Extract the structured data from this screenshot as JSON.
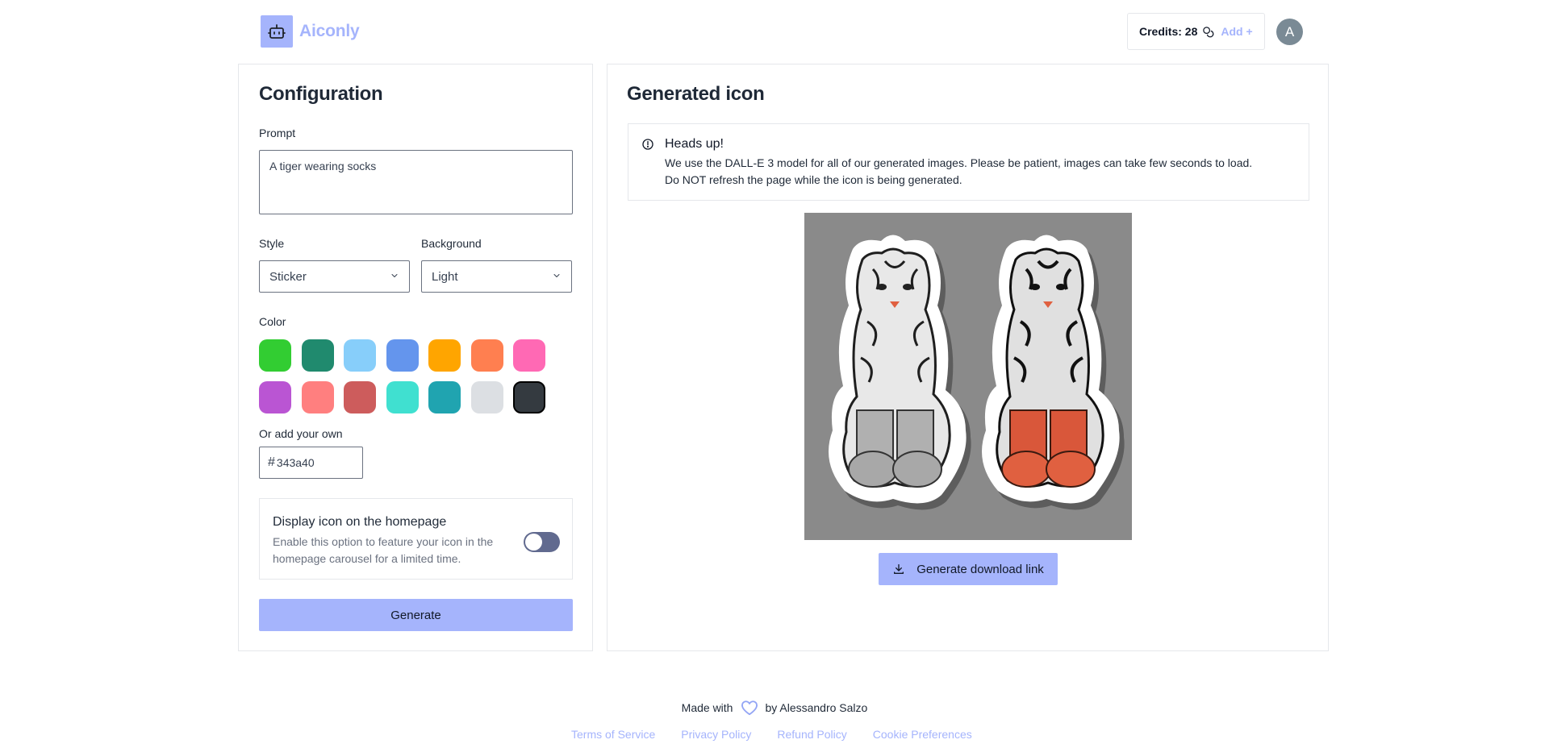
{
  "header": {
    "app_name": "Aiconly",
    "logo_icon": "robot-icon",
    "credits_label": "Credits: 28",
    "credits_icon": "coins-icon",
    "add_label": "Add +",
    "avatar_initial": "A"
  },
  "config": {
    "title": "Configuration",
    "prompt_label": "Prompt",
    "prompt_value": "A tiger wearing socks",
    "style_label": "Style",
    "style_value": "Sticker",
    "background_label": "Background",
    "background_value": "Light",
    "color_label": "Color",
    "colors": [
      "#32cd32",
      "#208a6e",
      "#87cefa",
      "#6495ed",
      "#ffa500",
      "#ff7f50",
      "#ff69b4",
      "#ba55d3",
      "#ff7f7f",
      "#cd5c5c",
      "#40e0d0",
      "#20a4b0",
      "#dcdfe3",
      "#343a40"
    ],
    "selected_color": "#343a40",
    "custom_label": "Or add your own",
    "custom_value": "343a40",
    "feature": {
      "title": "Display icon on the homepage",
      "description": "Enable this option to feature your icon in the homepage carousel for a limited time.",
      "enabled": false
    },
    "generate_label": "Generate"
  },
  "result": {
    "title": "Generated icon",
    "alert_icon": "info-circle-icon",
    "alert_title": "Heads up!",
    "alert_line1": "We use the DALL-E 3 model for all of our generated images. Please be patient, images can take few seconds to load.",
    "alert_line2": "Do NOT refresh the page while the icon is being generated.",
    "image_description": "tiger-sticker-image",
    "download_label": "Generate download link",
    "download_icon": "download-icon"
  },
  "footer": {
    "made_with": "Made with",
    "by": "by Alessandro Salzo",
    "heart_icon": "heart-icon",
    "links": [
      "Terms of Service",
      "Privacy Policy",
      "Refund Policy",
      "Cookie Preferences"
    ]
  }
}
